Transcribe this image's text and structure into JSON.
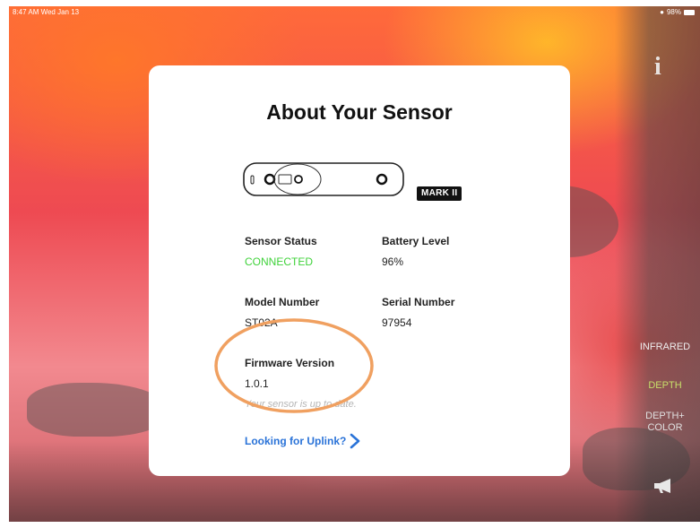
{
  "status_bar": {
    "time_date": "8:47 AM  Wed Jan 13",
    "battery": "98%"
  },
  "side_modes": {
    "infrared": "INFRARED",
    "depth": "DEPTH",
    "depth_color": "DEPTH+\nCOLOR"
  },
  "card": {
    "title": "About Your Sensor",
    "badge": "MARK II",
    "sensor_status_label": "Sensor Status",
    "sensor_status_value": "CONNECTED",
    "battery_label": "Battery Level",
    "battery_value": "96%",
    "model_label": "Model Number",
    "model_value": "ST02A",
    "serial_label": "Serial Number",
    "serial_value": "97954",
    "firmware_label": "Firmware Version",
    "firmware_value": "1.0.1",
    "firmware_note": "Your sensor is up to date.",
    "uplink_link": "Looking for Uplink?"
  },
  "colors": {
    "connected": "#3fd23a",
    "link": "#2a73d8",
    "highlight": "#f0a060",
    "depth_active": "#c7e06a"
  }
}
